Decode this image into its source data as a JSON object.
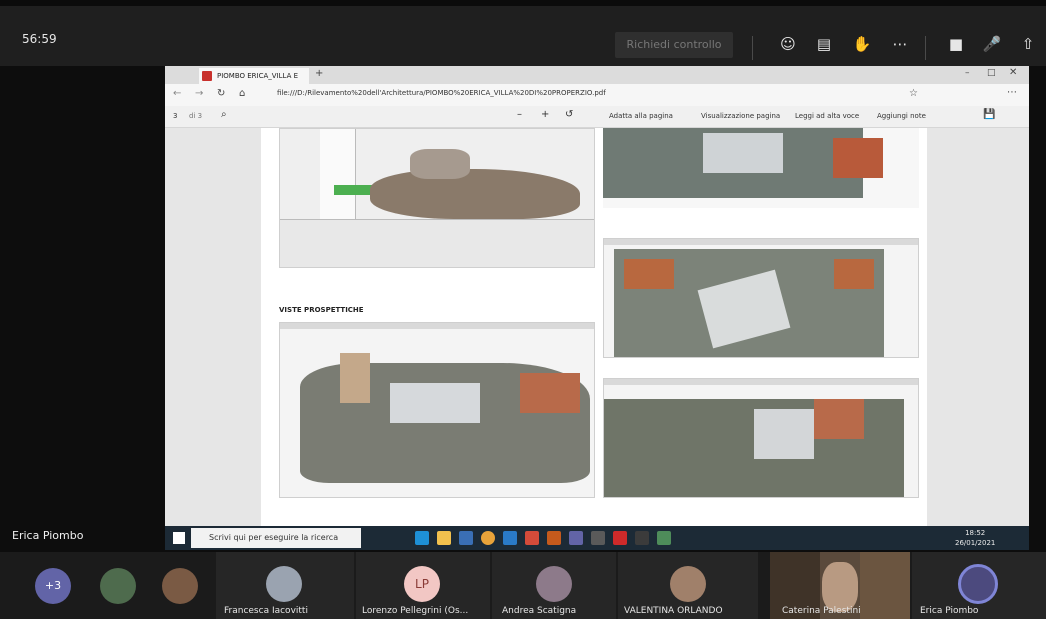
{
  "meeting": {
    "timer": "56:59",
    "request_control": "Richiedi controllo",
    "shared_by": "Erica Piombo"
  },
  "edge": {
    "tab_title": "PIOMBO ERICA_VILLA E",
    "url": "file:///D:/Rilevamento%20dell'Architettura/PIOMBO%20ERICA_VILLA%20DI%20PROPERZIO.pdf",
    "page_current": "3",
    "page_total": "di 3",
    "tools": {
      "fit": "Adatta alla pagina",
      "view": "Visualizzazione pagina",
      "read": "Leggi ad alta voce",
      "notes": "Aggiungi note"
    }
  },
  "pdf": {
    "section_title": "VISTE PROSPETTICHE"
  },
  "taskbar": {
    "search_placeholder": "Scrivi qui per eseguire la ricerca",
    "time": "18:52",
    "date": "26/01/2021"
  },
  "participants": {
    "overflow": "+3",
    "names": [
      "Francesca Iacovitti",
      "Lorenzo Pellegrini (Os...",
      "Andrea Scatigna",
      "VALENTINA ORLANDO",
      "Caterina Palestini",
      "Erica Piombo"
    ],
    "initials": "LP"
  },
  "colors": {
    "teams_bar": "#1f1f1f",
    "accent": "#6264a7",
    "lp_avatar": "#f2c7c4"
  },
  "icons": [
    "people-icon",
    "chat-icon",
    "raise-hand-icon",
    "more-icon",
    "camera-icon",
    "mic-icon",
    "share-icon"
  ]
}
